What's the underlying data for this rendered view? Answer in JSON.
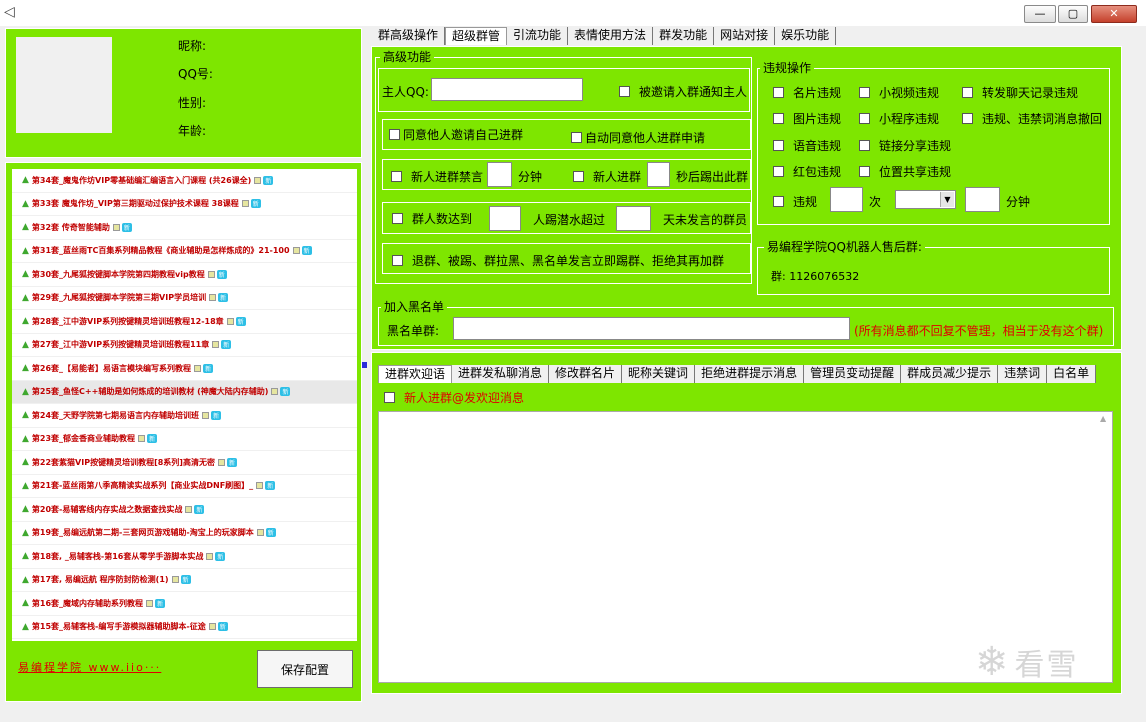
{
  "window": {
    "close_label": "✕",
    "min_label": "—",
    "max_label": "▢"
  },
  "profile": {
    "nickname_label": "昵称:",
    "qq_label": "QQ号:",
    "gender_label": "性别:",
    "age_label": "年龄:"
  },
  "courses": [
    "第34套_魔鬼作坊VIP零基础编汇编语言入门课程 (共26课全)",
    "第33套 魔鬼作坊_VIP第三期驱动过保护技术课程 38课程",
    "第32套 传奇智能辅助",
    "第31套_蓝丝雨TC百集系列精品教程《商业辅助是怎样炼成的》21-100",
    "第30套_九尾狐按键脚本学院第四期教程vip教程",
    "第29套_九尾狐按键脚本学院第三期VIP学员培训",
    "第28套_江中游VIP系列按键精灵培训班教程12-18章",
    "第27套_江中游VIP系列按键精灵培训班教程11章",
    "第26套_【易能者】易语言模块编写系列教程",
    "第25套_鱼怪C++辅助是如何炼成的培训教材 (神魔大陆内存辅助)",
    "第24套_天野学院第七期易语言内存辅助培训班",
    "第23套_郁金香商业辅助教程",
    "第22套紫猫VIP按键精灵培训教程[8系列]高清无密",
    "第21套-蓝丝雨第八季高精读实战系列【商业实战DNF刷图】_",
    "第20套-易辅客线内存实战之数据查找实战",
    "第19套_易编远航第二期-三套网页游戏辅助-淘宝上的玩家脚本",
    "第18套, _易辅客栈-第16套从零学手游脚本实战",
    "第17套, 易编远航 程序防封防检测(1)",
    "第16套_魔域内存辅助系列教程",
    "第15套_易辅客栈-编写手游模拟器辅助脚本-征途"
  ],
  "new_badge": "新",
  "footer_link": "易编程学院 www.iio···",
  "save_button": "保存配置",
  "top_tabs": [
    "群高级操作",
    "超级群管",
    "引流功能",
    "表情使用方法",
    "群发功能",
    "网站对接",
    "娱乐功能"
  ],
  "advanced": {
    "legend": "高级功能",
    "owner_qq_label": "主人QQ:",
    "notify_owner": "被邀请入群通知主人",
    "agree_invite": "同意他人邀请自己进群",
    "auto_agree": "自动同意他人进群申请",
    "new_member_mute": "新人进群禁言",
    "minutes": "分钟",
    "new_member_join": "新人进群",
    "kick_after": "秒后踢出此群",
    "member_reach": "群人数达到",
    "kick_lurk": "人踢潜水超过",
    "days_silent": "天未发言的群员",
    "leave_ban": "退群、被踢、群拉黑、黑名单发言立即踢群、拒绝其再加群"
  },
  "violation": {
    "legend": "违规操作",
    "items": [
      "名片违规",
      "小视频违规",
      "转发聊天记录违规",
      "图片违规",
      "小程序违规",
      "违规、违禁词消息撤回",
      "语音违规",
      "链接分享违规",
      "红包违规",
      "位置共享违规"
    ],
    "violate": "违规",
    "times": "次",
    "minutes": "分钟"
  },
  "support": {
    "legend": "易编程学院QQ机器人售后群:",
    "group": "群: 1126076532"
  },
  "blacklist": {
    "legend": "加入黑名单",
    "label": "黑名单群:",
    "note": "(所有消息都不回复不管理，相当于没有这个群)"
  },
  "bottom_tabs": [
    "进群欢迎语",
    "进群发私聊消息",
    "修改群名片",
    "昵称关键词",
    "拒绝进群提示消息",
    "管理员变动提醒",
    "群成员减少提示",
    "违禁词",
    "白名单"
  ],
  "welcome_at": "新人进群@发欢迎消息",
  "watermark": "看雪"
}
